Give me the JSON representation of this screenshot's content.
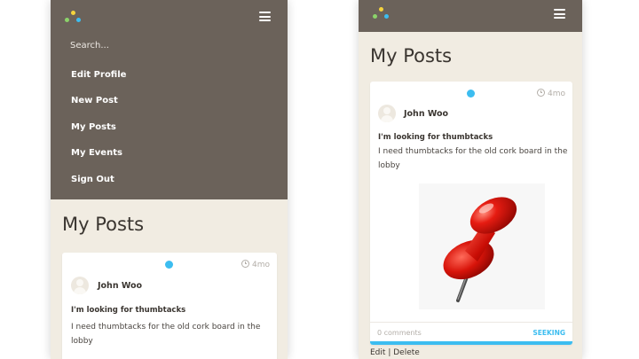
{
  "menu": {
    "search_placeholder": "Search...",
    "items": [
      "Edit Profile",
      "New Post",
      "My Posts",
      "My Events",
      "Sign Out"
    ]
  },
  "page_title": "My Posts",
  "post": {
    "timestamp": "4mo",
    "author": "John Woo",
    "title": "I'm looking for thumbtacks",
    "body_line1": "I need thumbtacks for the old cork board in the",
    "body_line2": "lobby",
    "comments": "0 comments",
    "status": "SEEKING",
    "edit_label": "Edit",
    "separator": "|",
    "delete_label": "Delete",
    "image_icon": "pushpin-image"
  },
  "colors": {
    "menu_background": "#6b625a",
    "page_background": "#f1ece2",
    "status_accent": "#3cbdf0",
    "logo_dots": [
      "#f5d33c",
      "#8bd36a",
      "#3cbdf0"
    ]
  }
}
